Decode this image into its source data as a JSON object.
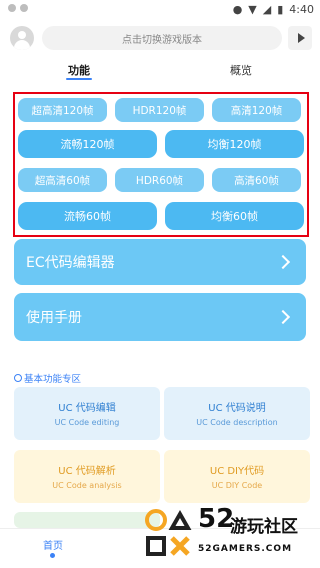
{
  "status_bar": {
    "time": "4:40"
  },
  "header": {
    "version_placeholder": "点击切换游戏版本"
  },
  "tabs": [
    {
      "label": "功能",
      "active": true
    },
    {
      "label": "概览",
      "active": false
    }
  ],
  "presets": {
    "row1": [
      "超高清120帧",
      "HDR120帧",
      "高清120帧"
    ],
    "row2": [
      "流畅120帧",
      "均衡120帧"
    ],
    "row3": [
      "超高清60帧",
      "HDR60帧",
      "高清60帧"
    ],
    "row4": [
      "流畅60帧",
      "均衡60帧"
    ]
  },
  "menu_cards": [
    {
      "label": "EC代码编辑器"
    },
    {
      "label": "使用手册"
    }
  ],
  "section": {
    "title": "基本功能专区"
  },
  "features": [
    {
      "title": "UC 代码编辑",
      "subtitle": "UC Code editing"
    },
    {
      "title": "UC 代码说明",
      "subtitle": "UC Code description"
    },
    {
      "title": "UC 代码解析",
      "subtitle": "UC Code analysis"
    },
    {
      "title": "UC DIY代码",
      "subtitle": "UC DIY Code"
    }
  ],
  "bottom_nav": {
    "home_label": "首页"
  },
  "watermark": {
    "number": "52",
    "name": "游玩社区",
    "url": "52GAMERS.COM"
  },
  "colors": {
    "accent": "#3b82f6",
    "pill": "#62c3f3",
    "highlight_box": "#e60012",
    "card_blue": "#6cc8f5"
  }
}
